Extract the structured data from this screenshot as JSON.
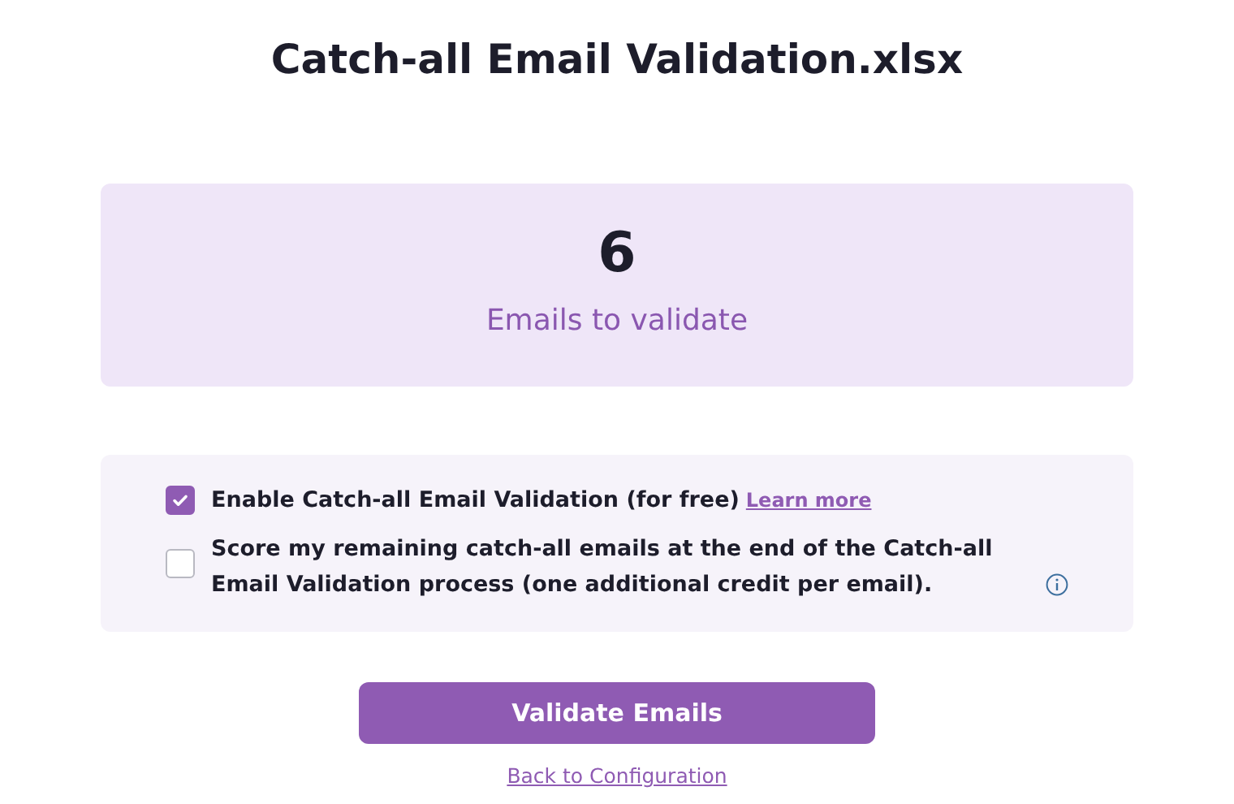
{
  "title": "Catch-all Email Validation.xlsx",
  "summary": {
    "count": "6",
    "label": "Emails to validate"
  },
  "options": [
    {
      "label": "Enable Catch-all Email Validation (for free)",
      "checked": true,
      "link": "Learn more",
      "info_icon": false
    },
    {
      "label": "Score my remaining catch-all emails at the end of the Catch-all Email Validation process (one additional credit per email).",
      "checked": false,
      "info_icon": true
    }
  ],
  "primary_button": "Validate Emails",
  "back_link": "Back to Configuration"
}
